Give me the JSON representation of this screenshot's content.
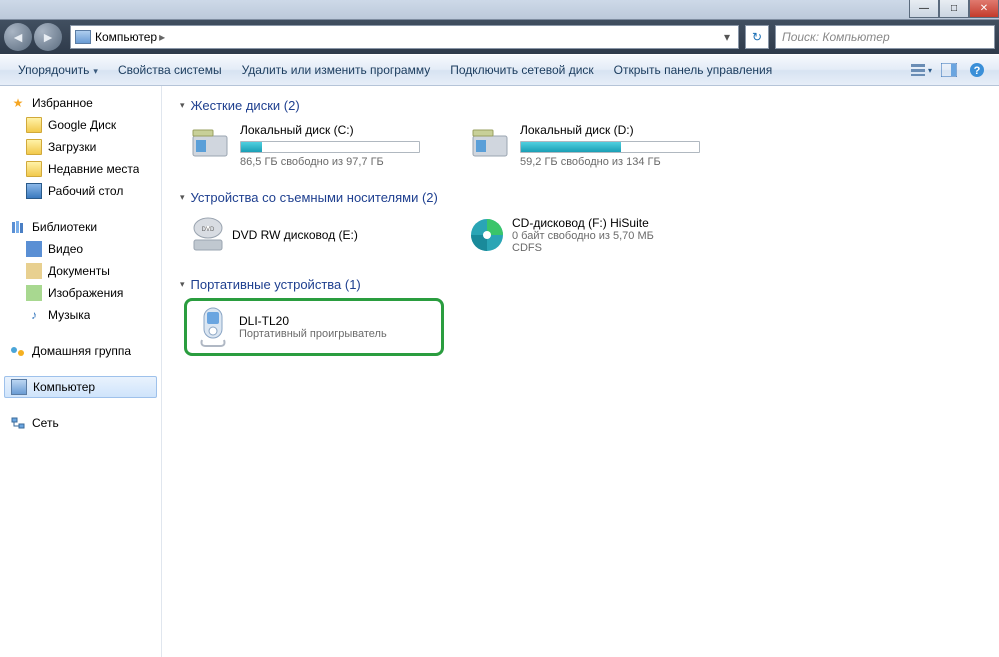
{
  "breadcrumb": {
    "root": "Компьютер"
  },
  "search": {
    "placeholder": "Поиск: Компьютер"
  },
  "toolbar": {
    "organize": "Упорядочить",
    "properties": "Свойства системы",
    "uninstall": "Удалить или изменить программу",
    "map_drive": "Подключить сетевой диск",
    "control_panel": "Открыть панель управления"
  },
  "sidebar": {
    "favorites": "Избранное",
    "fav_items": [
      "Google Диск",
      "Загрузки",
      "Недавние места",
      "Рабочий стол"
    ],
    "libraries": "Библиотеки",
    "lib_items": [
      "Видео",
      "Документы",
      "Изображения",
      "Музыка"
    ],
    "homegroup": "Домашняя группа",
    "computer": "Компьютер",
    "network": "Сеть"
  },
  "groups": {
    "hdd": {
      "title": "Жесткие диски (2)"
    },
    "removable": {
      "title": "Устройства со съемными носителями (2)"
    },
    "portable": {
      "title": "Портативные устройства (1)"
    }
  },
  "drives": {
    "c": {
      "title": "Локальный диск (C:)",
      "sub": "86,5 ГБ свободно из 97,7 ГБ",
      "fill": 12
    },
    "d": {
      "title": "Локальный диск (D:)",
      "sub": "59,2 ГБ свободно из 134 ГБ",
      "fill": 56
    },
    "dvd": {
      "title": "DVD RW дисковод (E:)"
    },
    "cd": {
      "title": "CD-дисковод (F:) HiSuite",
      "sub": "0 байт свободно из 5,70 МБ",
      "fs": "CDFS"
    },
    "portable": {
      "title": "DLI-TL20",
      "sub": "Портативный проигрыватель"
    }
  }
}
